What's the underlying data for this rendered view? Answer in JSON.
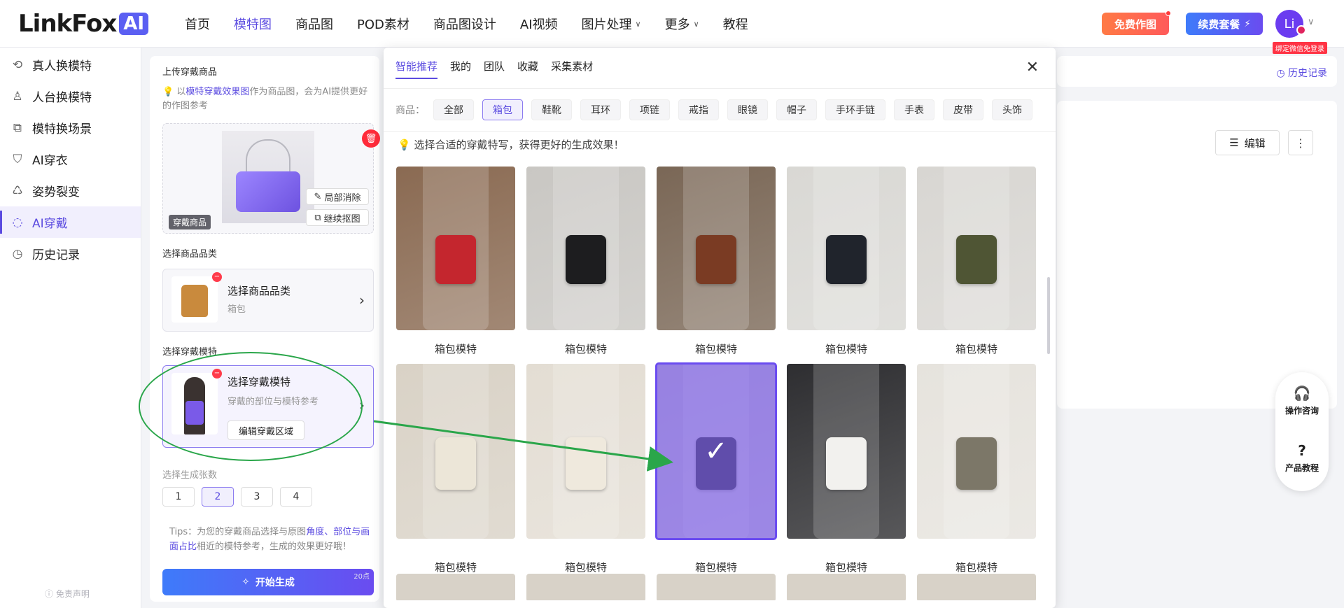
{
  "header": {
    "logo_text": "LinkFox",
    "logo_badge": "AI",
    "nav": [
      {
        "label": "首页",
        "active": false,
        "dropdown": false
      },
      {
        "label": "模特图",
        "active": true,
        "dropdown": false
      },
      {
        "label": "商品图",
        "active": false,
        "dropdown": false
      },
      {
        "label": "POD素材",
        "active": false,
        "dropdown": false
      },
      {
        "label": "商品图设计",
        "active": false,
        "dropdown": false
      },
      {
        "label": "AI视频",
        "active": false,
        "dropdown": false
      },
      {
        "label": "图片处理",
        "active": false,
        "dropdown": true
      },
      {
        "label": "更多",
        "active": false,
        "dropdown": true
      },
      {
        "label": "教程",
        "active": false,
        "dropdown": false
      }
    ],
    "free_btn": "免费作图",
    "renew_btn": "续费套餐",
    "avatar": "Li",
    "wechat_tag": "绑定微信免登录"
  },
  "sidebar": {
    "items": [
      {
        "label": "真人换模特",
        "icon": "person-swap-icon",
        "active": false
      },
      {
        "label": "人台换模特",
        "icon": "mannequin-icon",
        "active": false
      },
      {
        "label": "模特换场景",
        "icon": "scene-icon",
        "active": false
      },
      {
        "label": "AI穿衣",
        "icon": "shirt-icon",
        "active": false
      },
      {
        "label": "姿势裂变",
        "icon": "pose-icon",
        "active": false
      },
      {
        "label": "AI穿戴",
        "icon": "accessory-icon",
        "active": true
      },
      {
        "label": "历史记录",
        "icon": "history-icon",
        "active": false
      }
    ],
    "disclaimer": "免责声明"
  },
  "panel": {
    "upload_title": "上传穿戴商品",
    "hint_prefix": "以",
    "hint_link": "模特穿戴效果图",
    "hint_suffix": "作为商品图，会为AI提供更好的作图参考",
    "product_tag": "穿戴商品",
    "partial_erase": "局部消除",
    "continue_cutout": "继续抠图",
    "category_title": "选择商品品类",
    "category_card_title": "选择商品品类",
    "category_card_sub": "箱包",
    "model_title": "选择穿戴模特",
    "model_card_title": "选择穿戴模特",
    "model_card_sub": "穿戴的部位与模特参考",
    "edit_region": "编辑穿戴区域",
    "count_title": "选择生成张数",
    "counts": [
      "1",
      "2",
      "3",
      "4"
    ],
    "count_selected": "2",
    "tips_prefix": "Tips：为您的穿戴商品选择与原图",
    "tips_link": "角度、部位与画面占比",
    "tips_suffix": "相近的模特参考，生成的效果更好哦！",
    "generate_btn": "开始生成",
    "generate_points": "20点"
  },
  "right": {
    "history_link": "历史记录",
    "edit_btn": "编辑",
    "help_items": [
      "操作咨询",
      "产品教程"
    ]
  },
  "modal": {
    "tabs": [
      "智能推荐",
      "我的",
      "团队",
      "收藏",
      "采集素材"
    ],
    "active_tab": "智能推荐",
    "filter_label": "商品：",
    "chips": [
      "全部",
      "箱包",
      "鞋靴",
      "耳环",
      "项链",
      "戒指",
      "眼镜",
      "帽子",
      "手环手链",
      "手表",
      "皮带",
      "头饰"
    ],
    "active_chip": "箱包",
    "notice": "选择合适的穿戴特写，获得更好的生成效果！",
    "items": [
      {
        "label": "箱包模特",
        "bg": "#8a6a52",
        "accent": "#c4262e"
      },
      {
        "label": "箱包模特",
        "bg": "#c9c7c3",
        "accent": "#1d1d1f"
      },
      {
        "label": "箱包模特",
        "bg": "#7a6756",
        "accent": "#7a3b23"
      },
      {
        "label": "箱包模特",
        "bg": "#d9d8d4",
        "accent": "#20242c"
      },
      {
        "label": "箱包模特",
        "bg": "#d8d6d2",
        "accent": "#4f5534"
      },
      {
        "label": "箱包模特",
        "bg": "#d9d2c6",
        "accent": "#ece6d8"
      },
      {
        "label": "箱包模特",
        "bg": "#e3ddd3",
        "accent": "#efe9dd"
      },
      {
        "label": "箱包模特",
        "bg": "#b9b2c8",
        "accent": "#28283a"
      },
      {
        "label": "箱包模特",
        "bg": "#2e2e31",
        "accent": "#f2f1ee"
      },
      {
        "label": "箱包模特",
        "bg": "#e6e3dd",
        "accent": "#7c7768"
      }
    ],
    "selected_index": 7
  }
}
